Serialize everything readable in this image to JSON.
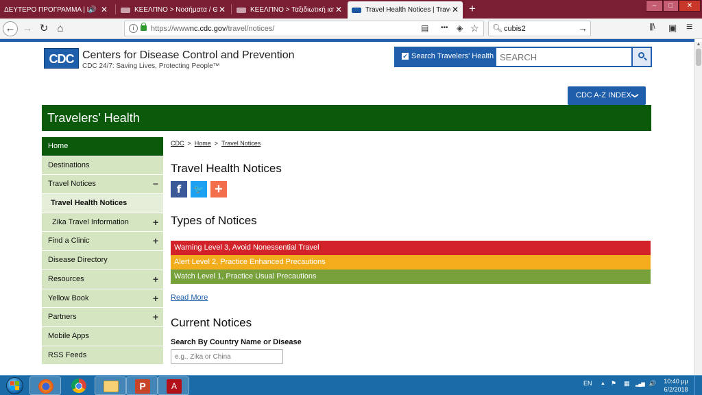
{
  "browser": {
    "tabs": [
      {
        "title": "ΔΕΥΤΕΡΟ ΠΡΟΓΡΑΜΜΑ | ΕΡΤ Ν",
        "sound": "🔊",
        "active": false
      },
      {
        "title": "ΚΕΕΛΠΝΟ > Νοσήματα / Θέμα",
        "active": false
      },
      {
        "title": "ΚΕΕΛΠΝΟ > Ταξιδιωτική ιατρι",
        "active": false
      },
      {
        "title": "Travel Health Notices | Travele",
        "active": true
      }
    ],
    "close_glyph": "✕",
    "new_tab_glyph": "+",
    "window_buttons": {
      "minimize": "–",
      "maximize": "□",
      "close": "✕"
    },
    "nav": {
      "back": "←",
      "forward": "→",
      "reload": "↻",
      "home": "⌂"
    },
    "url": {
      "prefix": "https://www",
      "domain": "nc.cdc.gov",
      "path": "/travel/notices/"
    },
    "url_icons": {
      "reader": "▤",
      "menu": "•••",
      "pocket": "◈",
      "bookmark": "☆"
    },
    "search_value": "cubis2",
    "toolbar_icons": {
      "library": "|||\\",
      "sidebar": "▣",
      "menu": "≡"
    }
  },
  "page": {
    "logo_text": "CDC",
    "org_name": "Centers for Disease Control and Prevention",
    "org_tagline": "CDC 24/7: Saving Lives, Protecting People™",
    "search": {
      "checkbox_label": "Search Travelers' Health",
      "placeholder": "SEARCH"
    },
    "az_index": "CDC A-Z INDEX",
    "az_chevron": "❯",
    "banner": "Travelers' Health",
    "sidebar": [
      {
        "label": "Home",
        "toggle": ""
      },
      {
        "label": "Destinations",
        "toggle": ""
      },
      {
        "label": "Travel Notices",
        "toggle": "−"
      },
      {
        "label": "Travel Health Notices",
        "toggle": ""
      },
      {
        "label": "Zika Travel Information",
        "toggle": "+"
      },
      {
        "label": "Find a Clinic",
        "toggle": "+"
      },
      {
        "label": "Disease Directory",
        "toggle": ""
      },
      {
        "label": "Resources",
        "toggle": "+"
      },
      {
        "label": "Yellow Book",
        "toggle": "+"
      },
      {
        "label": "Partners",
        "toggle": "+"
      },
      {
        "label": "Mobile Apps",
        "toggle": ""
      },
      {
        "label": "RSS Feeds",
        "toggle": ""
      }
    ],
    "breadcrumb": [
      "CDC",
      "Home",
      "Travel Notices"
    ],
    "breadcrumb_sep": ">",
    "heading": "Travel Health Notices",
    "social": {
      "facebook": "f",
      "twitter": "🐦",
      "share": "+"
    },
    "types_heading": "Types of Notices",
    "levels": [
      {
        "label": "Warning Level 3, Avoid Nonessential Travel",
        "color": "#d2232a"
      },
      {
        "label": "Alert Level 2, Practice Enhanced Precautions",
        "color": "#f3ad1c"
      },
      {
        "label": "Watch Level 1, Practice Usual Precautions",
        "color": "#77a13b"
      }
    ],
    "read_more": "Read More",
    "current_heading": "Current Notices",
    "country_search": {
      "label": "Search By Country Name or Disease",
      "placeholder": "e.g., Zika or China"
    }
  },
  "taskbar": {
    "apps": [
      "start-button",
      "firefox-icon",
      "chrome-icon",
      "file-explorer-icon",
      "powerpoint-icon",
      "acrobat-icon"
    ],
    "powerpoint_letter": "P",
    "acrobat_letter": "A",
    "lang": "EN",
    "tray_arrow": "▲",
    "tray_icons": {
      "flag": "⚑",
      "network": "▦",
      "signal": "▂▄▆",
      "volume": "🔊"
    },
    "time": "10:40 μμ",
    "date": "6/2/2018"
  }
}
